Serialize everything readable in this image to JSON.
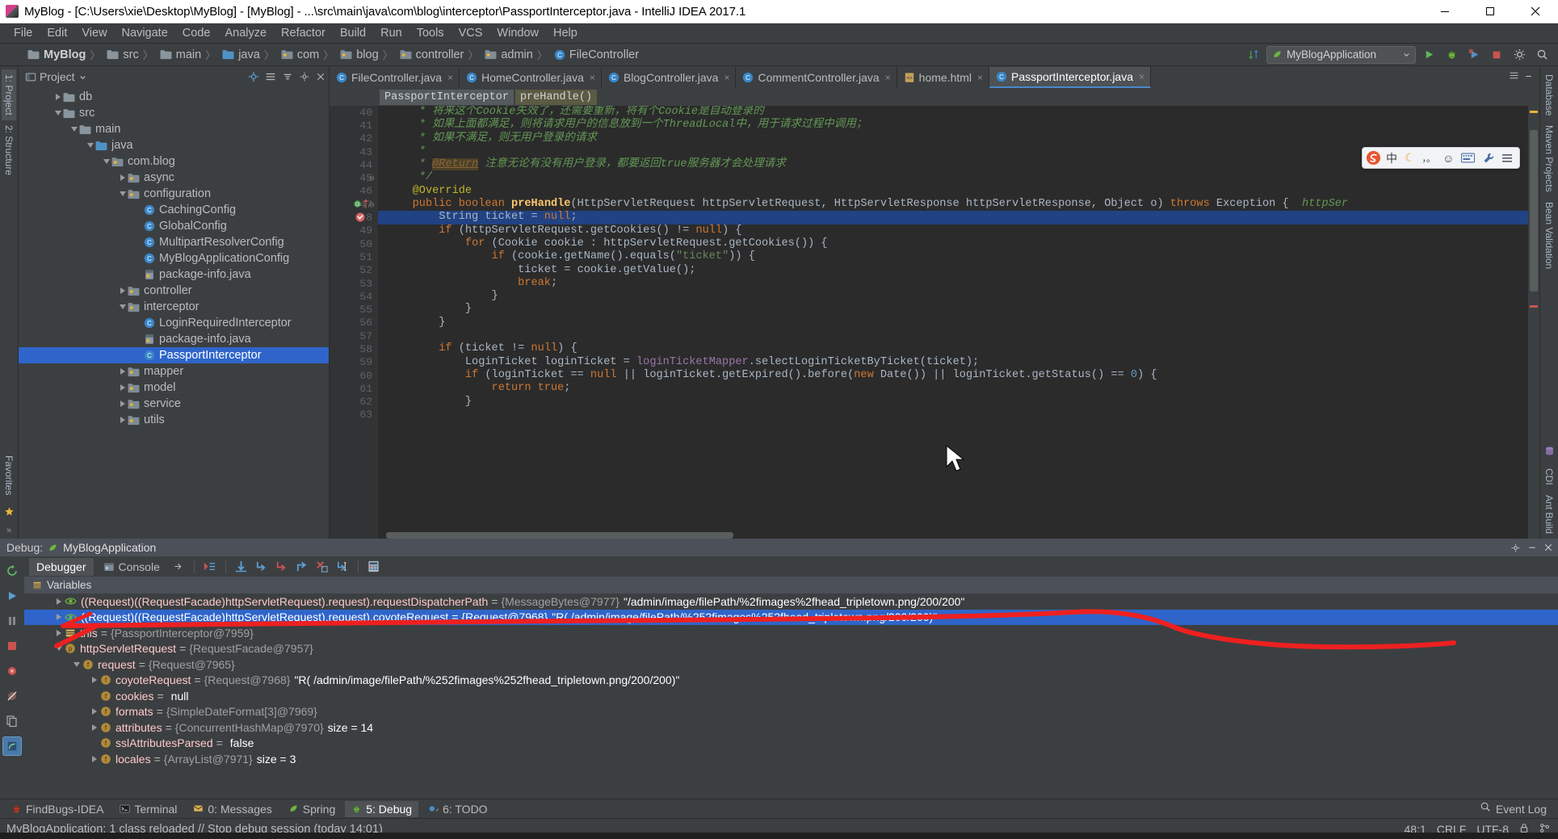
{
  "window": {
    "title": "MyBlog - [C:\\Users\\xie\\Desktop\\MyBlog] - [MyBlog] - ...\\src\\main\\java\\com\\blog\\interceptor\\PassportInterceptor.java - IntelliJ IDEA 2017.1",
    "minimize": "minimize-button",
    "maximize": "maximize-button",
    "close": "close-button"
  },
  "menubar": [
    "File",
    "Edit",
    "View",
    "Navigate",
    "Code",
    "Analyze",
    "Refactor",
    "Build",
    "Run",
    "Tools",
    "VCS",
    "Window",
    "Help"
  ],
  "navbar": {
    "crumbs": [
      "MyBlog",
      "src",
      "main",
      "java",
      "com",
      "blog",
      "controller",
      "admin",
      "FileController"
    ],
    "run_config": "MyBlogApplication"
  },
  "left_rail": [
    "1: Project",
    "2: Structure",
    "Favorites"
  ],
  "right_rail": [
    "Database",
    "Maven Projects",
    "Bean Validation",
    "CDI",
    "Ant Build"
  ],
  "project_pane": {
    "title": "Project",
    "tree": [
      {
        "label": "db",
        "indent": 1,
        "twisty": "closed",
        "icon": "folder",
        "sel": false
      },
      {
        "label": "src",
        "indent": 1,
        "twisty": "open",
        "icon": "folder",
        "sel": false
      },
      {
        "label": "main",
        "indent": 2,
        "twisty": "open",
        "icon": "folder",
        "sel": false
      },
      {
        "label": "java",
        "indent": 3,
        "twisty": "open",
        "icon": "folder-blue",
        "sel": false
      },
      {
        "label": "com.blog",
        "indent": 4,
        "twisty": "open",
        "icon": "package",
        "sel": false
      },
      {
        "label": "async",
        "indent": 5,
        "twisty": "closed",
        "icon": "package",
        "sel": false
      },
      {
        "label": "configuration",
        "indent": 5,
        "twisty": "open",
        "icon": "package",
        "sel": false
      },
      {
        "label": "CachingConfig",
        "indent": 6,
        "twisty": "none",
        "icon": "class",
        "sel": false
      },
      {
        "label": "GlobalConfig",
        "indent": 6,
        "twisty": "none",
        "icon": "class",
        "sel": false
      },
      {
        "label": "MultipartResolverConfig",
        "indent": 6,
        "twisty": "none",
        "icon": "class",
        "sel": false
      },
      {
        "label": "MyBlogApplicationConfig",
        "indent": 6,
        "twisty": "none",
        "icon": "class",
        "sel": false
      },
      {
        "label": "package-info.java",
        "indent": 6,
        "twisty": "none",
        "icon": "java-file",
        "sel": false
      },
      {
        "label": "controller",
        "indent": 5,
        "twisty": "closed",
        "icon": "package",
        "sel": false
      },
      {
        "label": "interceptor",
        "indent": 5,
        "twisty": "open",
        "icon": "package",
        "sel": false
      },
      {
        "label": "LoginRequiredInterceptor",
        "indent": 6,
        "twisty": "none",
        "icon": "class",
        "sel": false
      },
      {
        "label": "package-info.java",
        "indent": 6,
        "twisty": "none",
        "icon": "java-file",
        "sel": false
      },
      {
        "label": "PassportInterceptor",
        "indent": 6,
        "twisty": "none",
        "icon": "class",
        "sel": true
      },
      {
        "label": "mapper",
        "indent": 5,
        "twisty": "closed",
        "icon": "package",
        "sel": false
      },
      {
        "label": "model",
        "indent": 5,
        "twisty": "closed",
        "icon": "package",
        "sel": false
      },
      {
        "label": "service",
        "indent": 5,
        "twisty": "closed",
        "icon": "package",
        "sel": false
      },
      {
        "label": "utils",
        "indent": 5,
        "twisty": "closed",
        "icon": "package",
        "sel": false
      }
    ]
  },
  "editor": {
    "tabs": [
      {
        "label": "FileController.java",
        "icon": "class-icon",
        "active": false
      },
      {
        "label": "HomeController.java",
        "icon": "class-icon",
        "active": false
      },
      {
        "label": "BlogController.java",
        "icon": "class-icon",
        "active": false
      },
      {
        "label": "CommentController.java",
        "icon": "class-icon",
        "active": false
      },
      {
        "label": "home.html",
        "icon": "html-icon",
        "active": false
      },
      {
        "label": "PassportInterceptor.java",
        "icon": "class-icon",
        "active": true
      }
    ],
    "breadcrumb": [
      "PassportInterceptor",
      "preHandle()"
    ],
    "first_line": 40,
    "lines": [
      {
        "n": 40,
        "html": "     <span class=\"cm\">* 将来这个Cookie失效了，还需要重新，将有个Cookie是自动登录的</span>",
        "hl": false,
        "partial": true
      },
      {
        "n": 41,
        "html": "     <span class=\"cm\">* 如果上面都满足，则将请求用户的信息放到一个<i>ThreadLocal</i>中，用于请求过程中调用；</span>",
        "hl": false
      },
      {
        "n": 42,
        "html": "     <span class=\"cm\">* 如果不满足，则无用户登录的请求</span>",
        "hl": false
      },
      {
        "n": 43,
        "html": "     <span class=\"cm\">*</span>",
        "hl": false
      },
      {
        "n": 44,
        "html": "     <span class=\"cm\">* <span class=\"javadoc-tag\">@Return</span> 注意无论有没有用户登录，都要返回<i>true</i>服务器才会处理请求</span>",
        "hl": false
      },
      {
        "n": 45,
        "html": "     <span class=\"cm\">*/</span>",
        "hl": false
      },
      {
        "n": 46,
        "html": "    <span class=\"an\">@Override</span>",
        "hl": false
      },
      {
        "n": 47,
        "html": "    <span class=\"k\">public boolean</span> <span class=\"mth bold\">preHandle</span>(HttpServletRequest httpServletRequest, HttpServletResponse httpServletResponse, Object o) <span class=\"k\">throws</span> Exception {  <span class=\"cm\">httpSer</span>",
        "hl": false
      },
      {
        "n": 48,
        "html": "        String ticket = <span class=\"k\">null</span>;",
        "hl": true
      },
      {
        "n": 49,
        "html": "        <span class=\"k\">if</span> (httpServletRequest.getCookies() != <span class=\"k\">null</span>) {",
        "hl": false
      },
      {
        "n": 50,
        "html": "            <span class=\"k\">for</span> (Cookie cookie : httpServletRequest.getCookies()) {",
        "hl": false
      },
      {
        "n": 51,
        "html": "                <span class=\"k\">if</span> (cookie.getName().equals(<span class=\"s\">\"ticket\"</span>)) {",
        "hl": false
      },
      {
        "n": 52,
        "html": "                    ticket = cookie.getValue();",
        "hl": false
      },
      {
        "n": 53,
        "html": "                    <span class=\"k\">break</span>;",
        "hl": false
      },
      {
        "n": 54,
        "html": "                }",
        "hl": false
      },
      {
        "n": 55,
        "html": "            }",
        "hl": false
      },
      {
        "n": 56,
        "html": "        }",
        "hl": false
      },
      {
        "n": 57,
        "html": "",
        "hl": false
      },
      {
        "n": 58,
        "html": "        <span class=\"k\">if</span> (ticket != <span class=\"k\">null</span>) {",
        "hl": false
      },
      {
        "n": 59,
        "html": "            LoginTicket loginTicket = <span class=\"fld\">loginTicketMapper</span>.selectLoginTicketByTicket(ticket);",
        "hl": false
      },
      {
        "n": 60,
        "html": "            <span class=\"k\">if</span> (loginTicket == <span class=\"k\">null</span> || loginTicket.getExpired().before(<span class=\"k\">new</span> Date()) || loginTicket.getStatus() == <span class=\"n\">0</span>) {",
        "hl": false
      },
      {
        "n": 61,
        "html": "                <span class=\"k\">return true</span>;",
        "hl": false
      },
      {
        "n": 62,
        "html": "            }",
        "hl": false
      },
      {
        "n": 63,
        "html": "",
        "hl": false
      }
    ]
  },
  "ime_bar": {
    "items": [
      "S-logo",
      "中",
      "moon",
      "comma-dot",
      "smiley",
      "keyboard",
      "wrench",
      "menu"
    ]
  },
  "debug": {
    "header_title": "Debug:",
    "app_name": "MyBlogApplication",
    "tabs": [
      {
        "label": "Debugger",
        "icon": "debugger-icon",
        "active": true
      },
      {
        "label": "Console",
        "icon": "console-icon",
        "active": false
      }
    ],
    "toolbar_icons": [
      "restore-layout-icon",
      "step-over-icon",
      "step-into-icon",
      "force-step-into-icon",
      "step-out-icon",
      "drop-frame-icon",
      "run-to-cursor-icon",
      "evaluate-expression-icon"
    ],
    "variables_label": "Variables",
    "left_toolbar": [
      "rerun-icon",
      "resume-icon",
      "pause-icon",
      "stop-icon",
      "view-breakpoints-icon",
      "mute-breakpoints-icon",
      "settings-icon",
      "restore-icon",
      "threads-icon"
    ],
    "rows": [
      {
        "indent": 1,
        "twisty": "closed",
        "icon": "watch-eval",
        "name": "((Request)((RequestFacade)httpServletRequest).request).requestDispatcherPath",
        "type": "{MessageBytes@7977}",
        "value": "\"/admin/image/filePath/%2fimages%2fhead_tripletown.png/200/200\"",
        "sel": false
      },
      {
        "indent": 1,
        "twisty": "closed",
        "icon": "watch-eval",
        "name": "((Request)((RequestFacade)httpServletRequest).request).coyoteRequest",
        "type": "{Request@7968}",
        "value": "\"R( /admin/image/filePath/%252fimages%252fhead_tripletown.png/200/200)\"",
        "sel": true
      },
      {
        "indent": 1,
        "twisty": "closed",
        "icon": "this",
        "name": "this",
        "type": "{PassportInterceptor@7959}",
        "value": "",
        "sel": false
      },
      {
        "indent": 1,
        "twisty": "open",
        "icon": "param",
        "name": "httpServletRequest",
        "type": "{RequestFacade@7957}",
        "value": "",
        "sel": false
      },
      {
        "indent": 2,
        "twisty": "open",
        "icon": "field",
        "name": "request",
        "type": "{Request@7965}",
        "value": "",
        "sel": false
      },
      {
        "indent": 3,
        "twisty": "closed",
        "icon": "field",
        "name": "coyoteRequest",
        "type": "{Request@7968}",
        "value": "\"R( /admin/image/filePath/%252fimages%252fhead_tripletown.png/200/200)\"",
        "sel": false
      },
      {
        "indent": 3,
        "twisty": "none",
        "icon": "field",
        "name": "cookies",
        "type": "",
        "value": "null",
        "sel": false
      },
      {
        "indent": 3,
        "twisty": "closed",
        "icon": "field",
        "name": "formats",
        "type": "{SimpleDateFormat[3]@7969}",
        "value": "",
        "sel": false
      },
      {
        "indent": 3,
        "twisty": "closed",
        "icon": "field",
        "name": "attributes",
        "type": "{ConcurrentHashMap@7970}",
        "value": "size = 14",
        "sel": false
      },
      {
        "indent": 3,
        "twisty": "none",
        "icon": "field",
        "name": "sslAttributesParsed",
        "type": "",
        "value": "false",
        "sel": false
      },
      {
        "indent": 3,
        "twisty": "closed",
        "icon": "field",
        "name": "locales",
        "type": "{ArrayList@7971}",
        "value": "size = 3",
        "sel": false
      }
    ]
  },
  "toolwindow_bar": {
    "items": [
      {
        "label": "FindBugs-IDEA",
        "icon": "findbugs-icon",
        "active": false
      },
      {
        "label": "Terminal",
        "icon": "terminal-icon",
        "active": false
      },
      {
        "label": "0: Messages",
        "icon": "messages-icon",
        "active": false
      },
      {
        "label": "Spring",
        "icon": "spring-icon",
        "active": false
      },
      {
        "label": "5: Debug",
        "icon": "debug-icon",
        "active": true
      },
      {
        "label": "6: TODO",
        "icon": "todo-icon",
        "active": false
      }
    ],
    "event_log": "Event Log"
  },
  "statusbar": {
    "message": "MyBlogApplication: 1 class reloaded // Stop debug session (today 14:01)",
    "caret": "48:1",
    "line_ending": "CRLF",
    "encoding": "UTF-8",
    "lock": "lock-icon",
    "branch": "branch-icon"
  },
  "colors": {
    "bg_dark": "#2b2b2b",
    "bg_panel": "#3c3f41",
    "accent_blue": "#2f65ca",
    "selection": "#214283",
    "keyword": "#cc7832",
    "string": "#6a8759",
    "comment": "#629755",
    "annotation": "#bbb529",
    "field": "#9876aa",
    "method": "#ffc66d",
    "number": "#6897bb",
    "annotation_red": "#ee2222"
  }
}
